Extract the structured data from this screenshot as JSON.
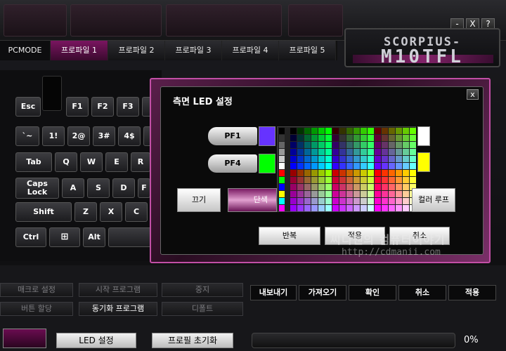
{
  "window": {
    "logo_top": "SCORPIUS-",
    "logo_bottom": "M10TFL",
    "minimize": "-",
    "close": "X",
    "help": "?"
  },
  "tabs": [
    {
      "label": "PCMODE"
    },
    {
      "label": "프로파일 1"
    },
    {
      "label": "프로파일 2"
    },
    {
      "label": "프로파일 3"
    },
    {
      "label": "프로파일 4"
    },
    {
      "label": "프로파일 5"
    }
  ],
  "keyboard": {
    "row1": [
      "Esc",
      "F1",
      "F2",
      "F3"
    ],
    "row2": [
      "`~",
      "1!",
      "2@",
      "3#",
      "4$"
    ],
    "row3": [
      "Tab",
      "Q",
      "W",
      "E",
      "R"
    ],
    "row4": [
      "Caps Lock",
      "A",
      "S",
      "D",
      "F"
    ],
    "row5": [
      "Shift",
      "Z",
      "X",
      "C"
    ],
    "row6": [
      "Ctrl",
      "Alt"
    ]
  },
  "dialog": {
    "title": "측면 LED 설정",
    "close": "x",
    "pf1": "PF1",
    "pf4": "PF4",
    "mode_off": "끄기",
    "mode_single": "단색",
    "mode_loop": "컬러 루프",
    "repeat": "반복",
    "apply": "적용",
    "cancel": "취소"
  },
  "colors": {
    "pf1_swatch": "#6633ff",
    "pf4_swatch": "#00ff00",
    "right_top": "#ffffff",
    "right_bottom": "#ffff00",
    "accent": "#c24fa6"
  },
  "left_buttons": {
    "macro": "매크로 설정",
    "start": "시작 프로그램",
    "stop": "중지",
    "assign": "버튼 할당",
    "sync": "동기화 프로그램",
    "default": "디폴트"
  },
  "right_buttons": [
    "내보내기",
    "가져오기",
    "확인",
    "취소",
    "적용"
  ],
  "bottom": {
    "led": "LED 설정",
    "reset": "프로필 초기화",
    "progress_value": 0,
    "progress_text": "0%"
  },
  "watermark": {
    "line1": "씨디맨의 컴퓨터이야기",
    "line2": "http://cdmanii.com"
  }
}
